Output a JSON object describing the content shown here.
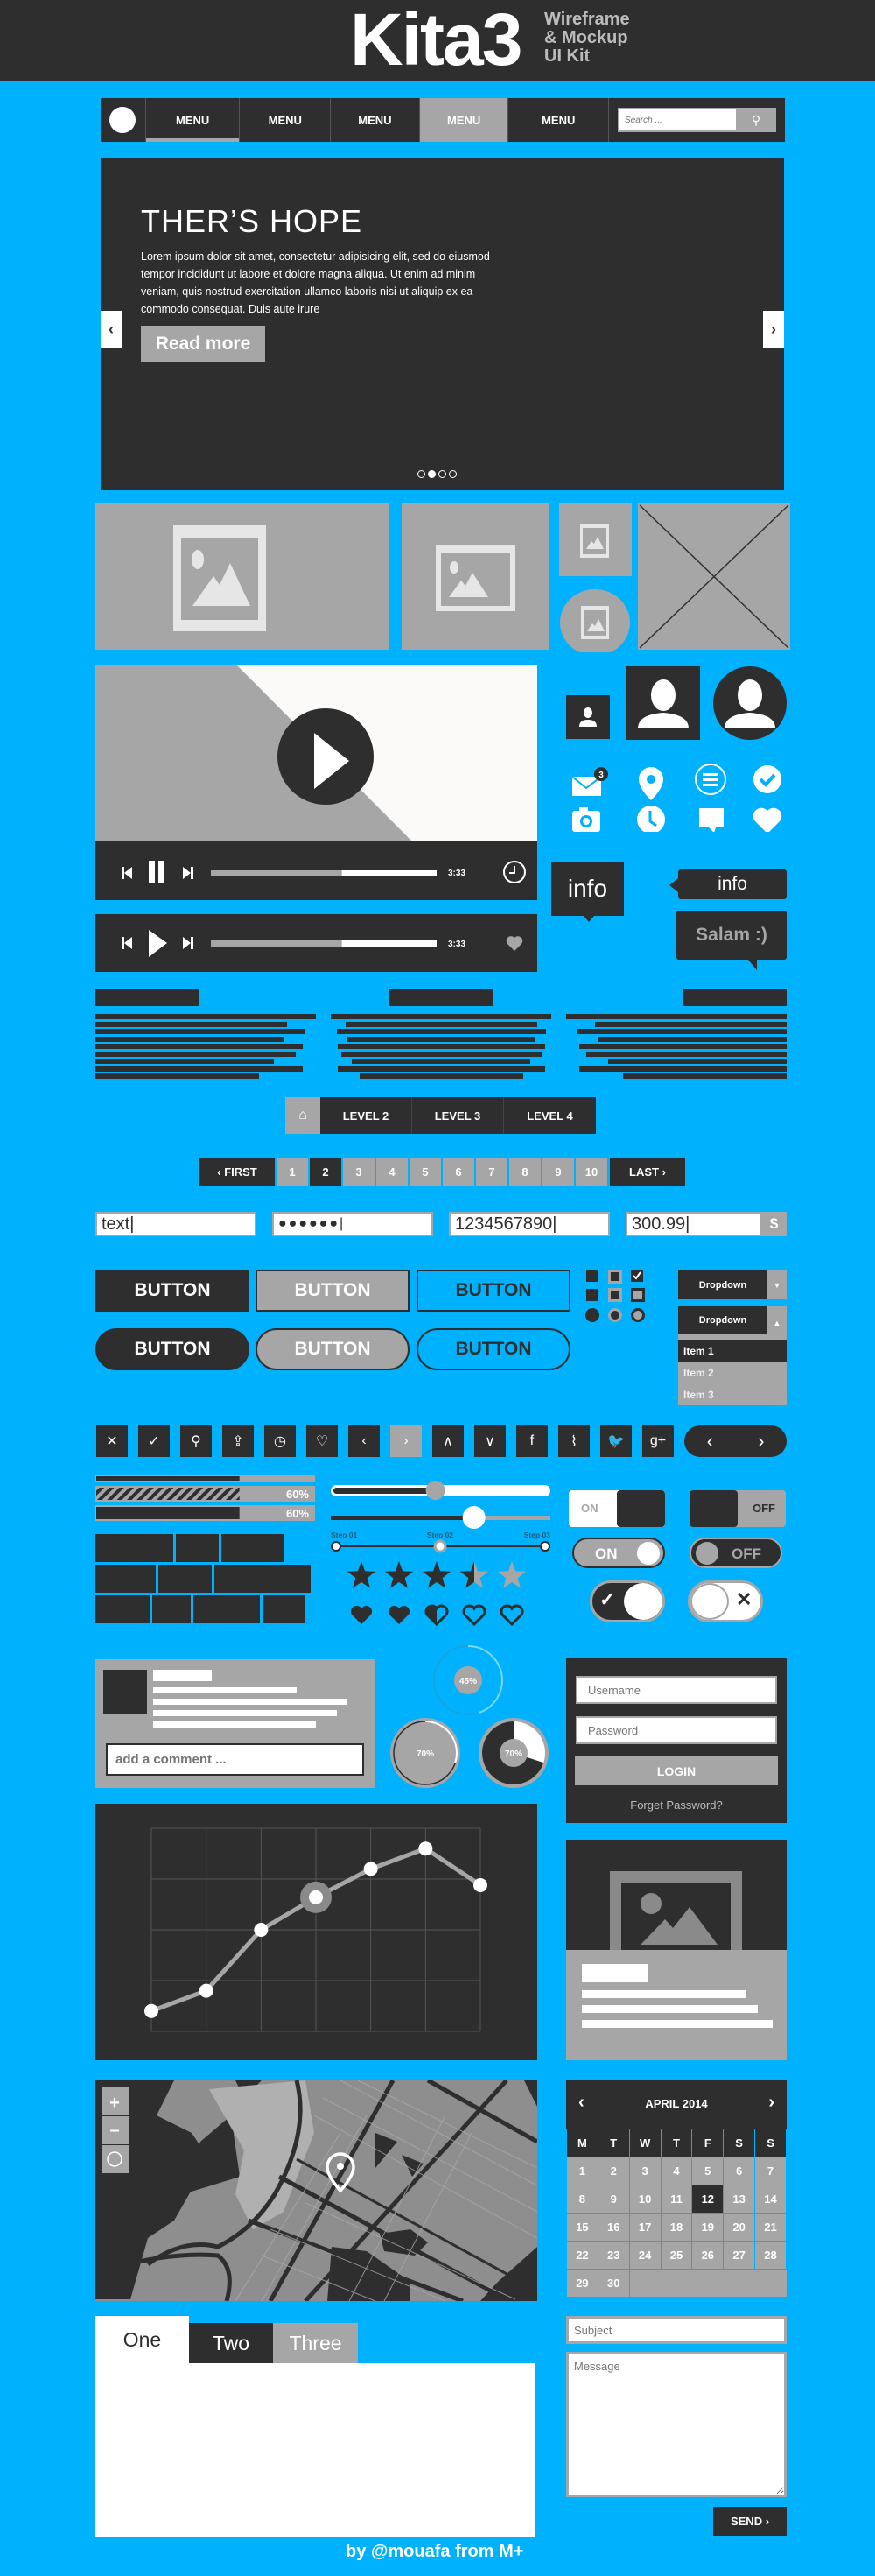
{
  "header": {
    "logo": "Kita3",
    "subtitle_lines": [
      "Wireframe",
      "& Mockup",
      "UI Kit"
    ]
  },
  "nav": {
    "items": [
      {
        "label": "MENU",
        "state": "underlined"
      },
      {
        "label": "MENU",
        "state": "normal"
      },
      {
        "label": "MENU",
        "state": "normal"
      },
      {
        "label": "MENU",
        "state": "active"
      },
      {
        "label": "MENU",
        "state": "normal"
      }
    ],
    "search_placeholder": "Search ...",
    "search_icon": "search-icon"
  },
  "hero": {
    "title": "THER’S HOPE",
    "body": "Lorem ipsum dolor sit amet, consectetur adipisicing elit, sed do eiusmod tempor incididunt ut labore et dolore magna aliqua. Ut enim ad minim veniam, quis nostrud exercitation ullamco laboris nisi ut aliquip ex ea commodo consequat. Duis aute irure",
    "button": "Read more",
    "prev": "‹",
    "next": "›",
    "slides": 4,
    "active_slide": 2
  },
  "video": {
    "time": "3:33",
    "progress": 0.58
  },
  "audio": {
    "time": "3:33",
    "progress": 0.58
  },
  "icons": {
    "mail_badge": "3",
    "grid": [
      "mail-icon",
      "location-pin-icon",
      "menu-circle-icon",
      "check-circle-icon",
      "camera-icon",
      "clock-icon",
      "chat-icon",
      "heart-icon"
    ]
  },
  "tooltips": {
    "info1": "info",
    "info2": "info",
    "salam": "Salam :)"
  },
  "breadcrumb": {
    "home_icon": "home-icon",
    "levels": [
      "LEVEL 2",
      "LEVEL 3",
      "LEVEL 4"
    ]
  },
  "pagination": {
    "first": "‹ FIRST",
    "last": "LAST ›",
    "pages": [
      "1",
      "2",
      "3",
      "4",
      "5",
      "6",
      "7",
      "8",
      "9",
      "10"
    ],
    "current": "2"
  },
  "inputs": {
    "text": "text",
    "password": "●●●●●●",
    "number": "1234567890",
    "currency": "300.99",
    "currency_symbol": "$"
  },
  "buttons": {
    "label": "BUTTON"
  },
  "dropdowns": {
    "label": "Dropdown",
    "items": [
      "Item 1",
      "Item 2",
      "Item 3"
    ],
    "selected": "Item 1"
  },
  "icon_bar": {
    "icons": [
      "close-icon",
      "check-icon",
      "search-icon",
      "share-icon",
      "clock-icon",
      "heart-outline-icon",
      "chevron-left-icon",
      "chevron-right-icon",
      "chevron-up-icon",
      "chevron-down-icon",
      "facebook-icon",
      "rss-icon",
      "twitter-icon",
      "google-plus-icon"
    ],
    "glyphs": [
      "✕",
      "✓",
      "⚲",
      "⇪",
      "◷",
      "♡",
      "‹",
      "›",
      "∧",
      "∨",
      "f",
      "⌇",
      "🐦",
      "g+"
    ],
    "pager_prev": "‹",
    "pager_next": "›"
  },
  "progress": {
    "bar1": 0.66,
    "bar2_label": "60%",
    "bar2": 0.66,
    "bar3_label": "60%",
    "bar3": 0.66
  },
  "sliders": {
    "slider1": 0.47,
    "slider2": 0.66,
    "steps": [
      "Step 01",
      "Step 02",
      "Step 03"
    ],
    "current_step": 2
  },
  "rating": {
    "stars": 3.5,
    "max": 5,
    "hearts": 2.5
  },
  "toggles": {
    "on": "ON",
    "off": "OFF"
  },
  "comment": {
    "placeholder": "add a comment ..."
  },
  "donuts": {
    "d1": "45%",
    "d1_value": 0.45,
    "d2": "70%",
    "d2_value": 0.7,
    "d3": "70%",
    "d3_value": 0.7
  },
  "login": {
    "username_placeholder": "Username",
    "password_placeholder": "Password",
    "button": "LOGIN",
    "forgot": "Forget Password?"
  },
  "chart_data": {
    "type": "line",
    "title": "",
    "xlabel": "",
    "ylabel": "",
    "x": [
      1,
      2,
      3,
      4,
      5,
      6,
      7
    ],
    "values": [
      0.5,
      1.0,
      2.5,
      3.3,
      4.0,
      4.5,
      3.6
    ],
    "highlighted_index": 3,
    "ylim": [
      0,
      5
    ],
    "grid": true
  },
  "calendar": {
    "month": "APRIL 2014",
    "prev": "‹",
    "next": "›",
    "weekdays": [
      "M",
      "T",
      "W",
      "T",
      "F",
      "S",
      "S"
    ],
    "weeks": [
      [
        "1",
        "2",
        "3",
        "4",
        "5",
        "6",
        "7"
      ],
      [
        "8",
        "9",
        "10",
        "11",
        "12",
        "13",
        "14"
      ],
      [
        "15",
        "16",
        "17",
        "18",
        "19",
        "20",
        "21"
      ],
      [
        "22",
        "23",
        "24",
        "25",
        "26",
        "27",
        "28"
      ],
      [
        "29",
        "30",
        "",
        "",
        "",
        "",
        ""
      ]
    ],
    "selected": "12"
  },
  "tabs": {
    "items": [
      "One",
      "Two",
      "Three"
    ],
    "active": "One"
  },
  "contact": {
    "subject_placeholder": "Subject",
    "message_placeholder": "Message",
    "send": "SEND ›"
  },
  "footer": {
    "credit_prefix": "by @mouafa from ",
    "credit_brand": "M+"
  }
}
